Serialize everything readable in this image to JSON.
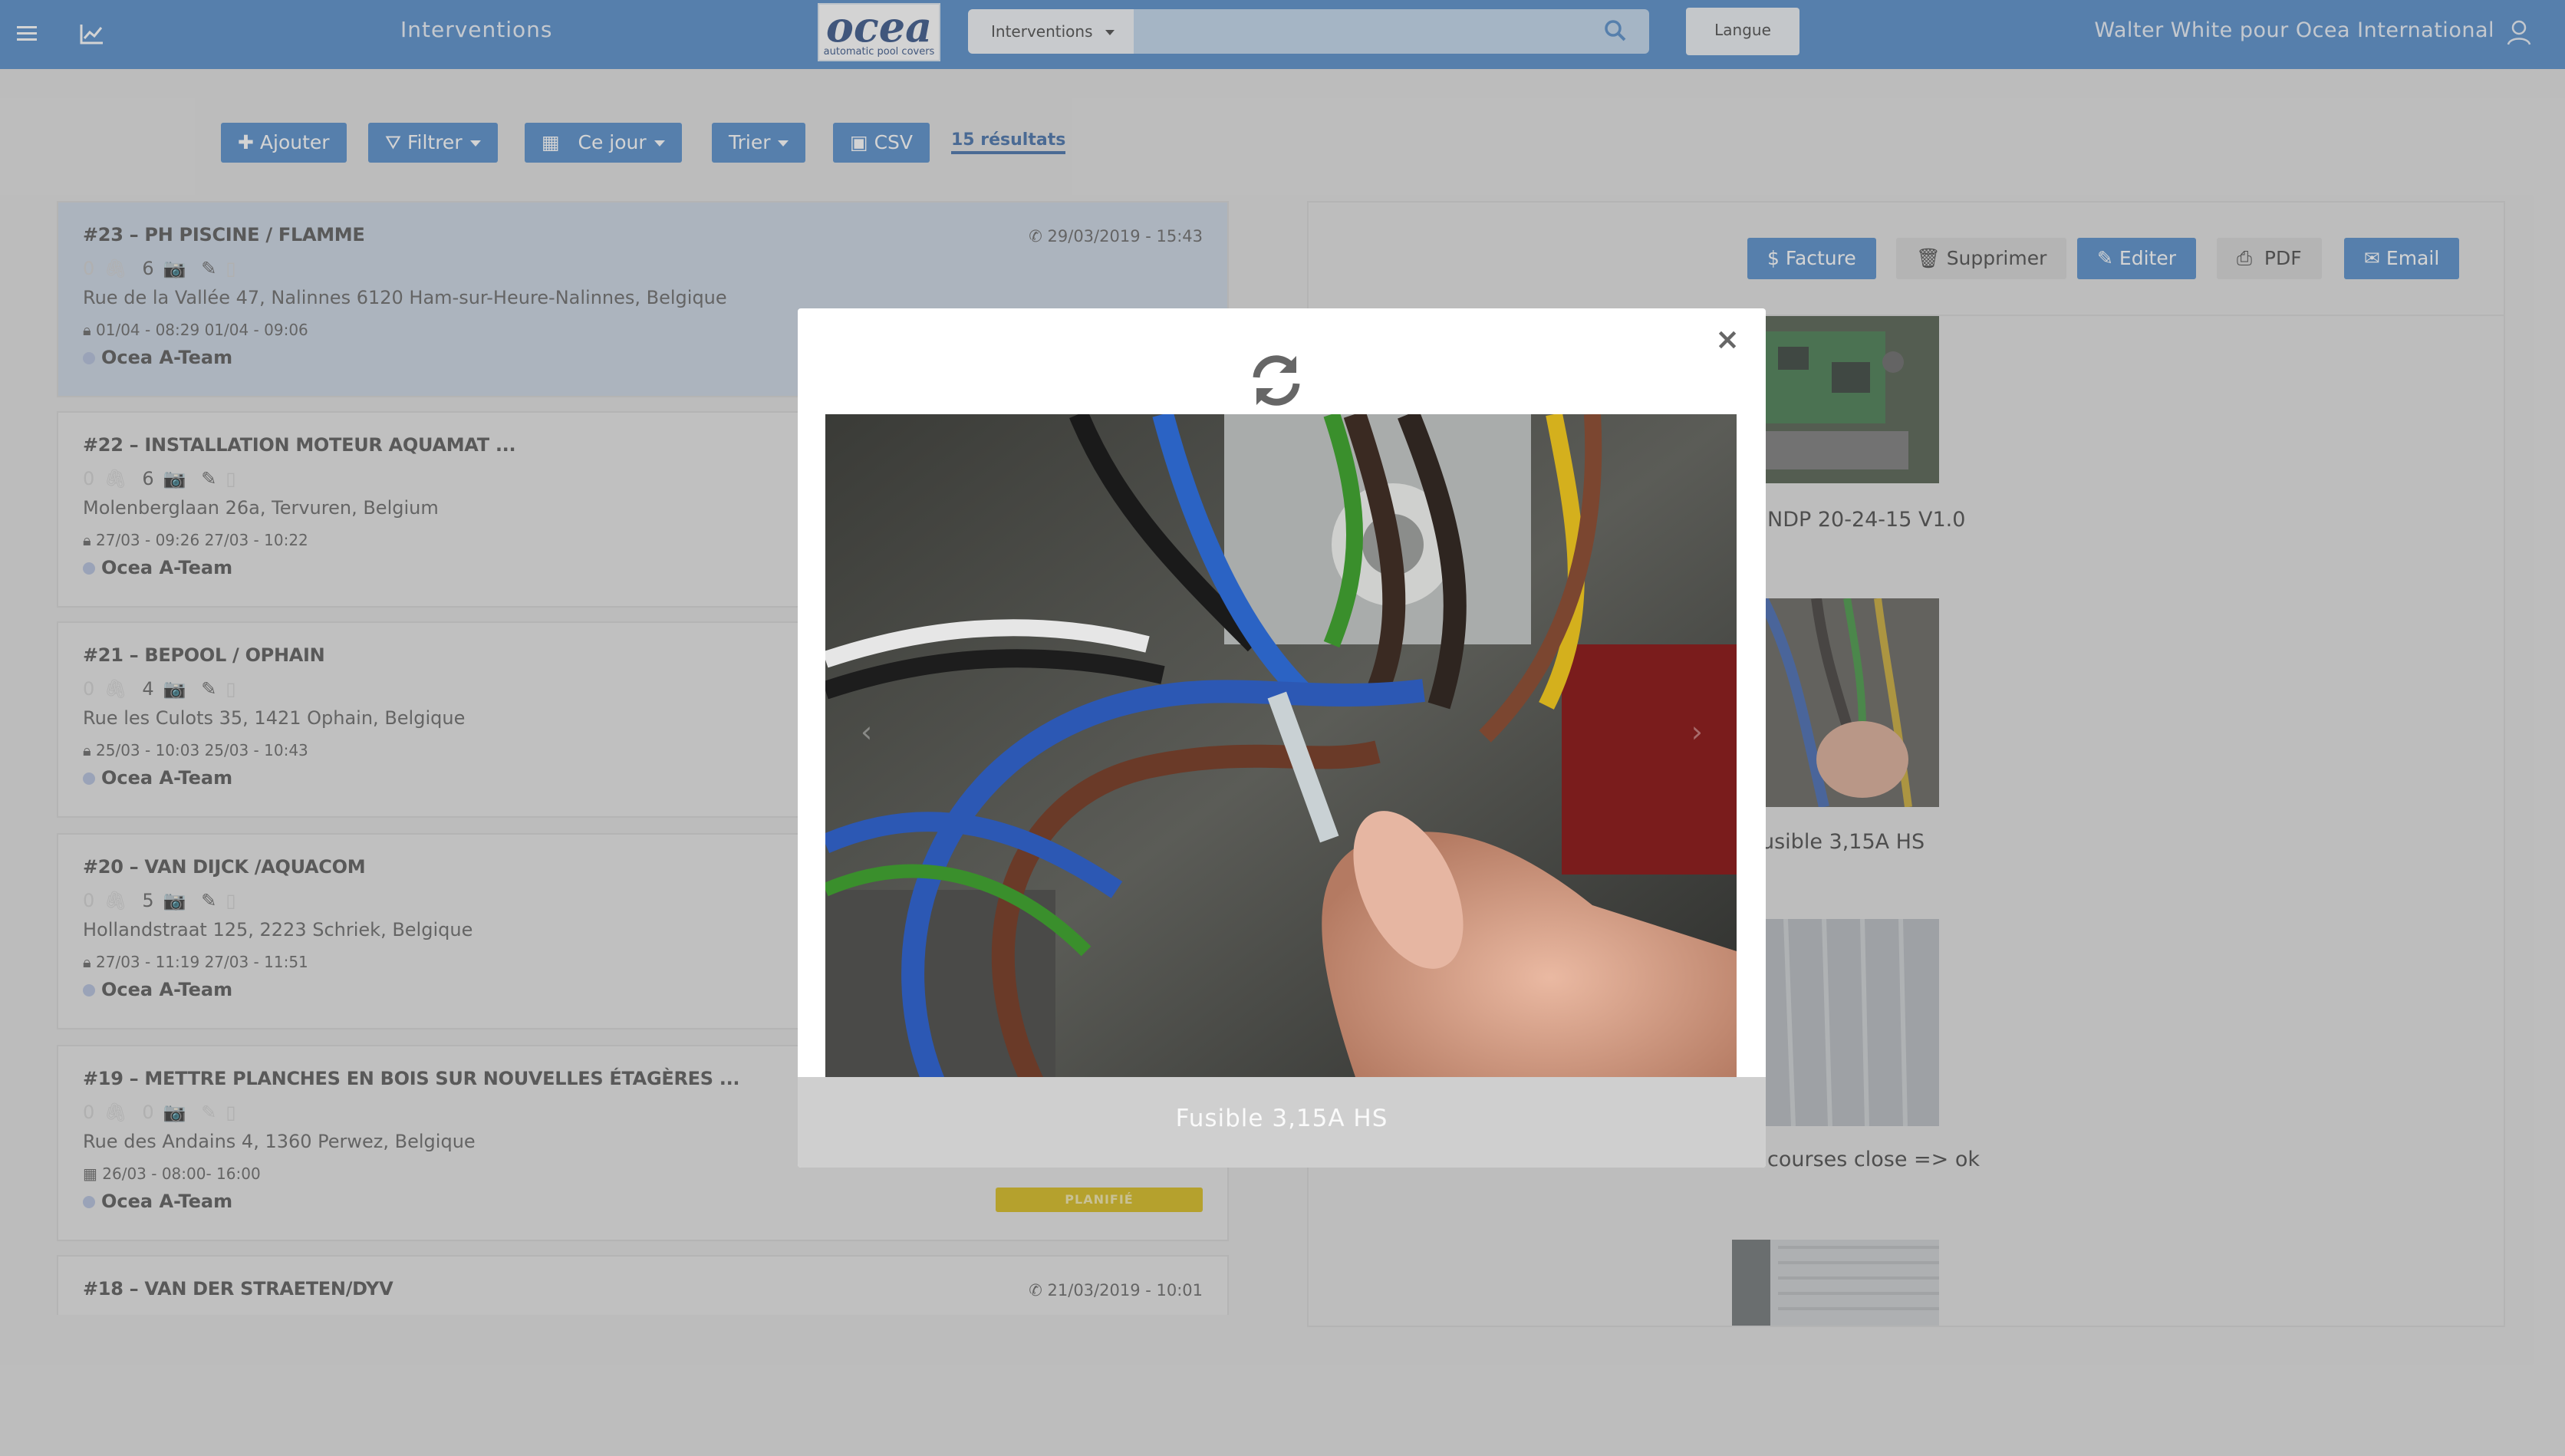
{
  "header": {
    "title": "Interventions",
    "logo_word": "ocea",
    "logo_tagline": "automatic pool covers",
    "search_scope": "Interventions",
    "language_button": "Langue",
    "user": "Walter White pour Ocea International"
  },
  "toolbar": {
    "add": "Ajouter",
    "filter": "Filtrer",
    "date": "Ce jour",
    "sort": "Trier",
    "csv": "CSV",
    "results": "15 résultats"
  },
  "list": {
    "items": [
      {
        "title": "#23 – PH PISCINE / FLAMME",
        "when": "29/03/2019 - 15:43",
        "attach": "0",
        "photos": "6",
        "address": "Rue de la Vallée 47, Nalinnes 6120 Ham-sur-Heure-Nalinnes, Belgique",
        "schedule": "01/04 - 08:29 01/04 - 09:06",
        "team": "Ocea A-Team"
      },
      {
        "title": "#22 – INSTALLATION MOTEUR AQUAMAT ...",
        "when": "",
        "attach": "0",
        "photos": "6",
        "address": "Molenberglaan 26a, Tervuren, Belgium",
        "schedule": "27/03 - 09:26 27/03 - 10:22",
        "team": "Ocea A-Team"
      },
      {
        "title": "#21 – BEPOOL / OPHAIN",
        "when": "",
        "attach": "0",
        "photos": "4",
        "address": "Rue les Culots 35, 1421 Ophain, Belgique",
        "schedule": "25/03 - 10:03 25/03 - 10:43",
        "team": "Ocea A-Team"
      },
      {
        "title": "#20 – VAN DIJCK /AQUACOM",
        "when": "",
        "attach": "0",
        "photos": "5",
        "address": "Hollandstraat 125, 2223 Schriek, Belgique",
        "schedule": "27/03 - 11:19 27/03 - 11:51",
        "team": "Ocea A-Team"
      },
      {
        "title": "#19 – METTRE PLANCHES EN BOIS SUR NOUVELLES ÉTAGÈRES ...",
        "when": "",
        "attach": "0",
        "photos": "0",
        "address": "Rue des Andains 4, 1360 Perwez, Belgique",
        "schedule": "26/03 - 08:00- 16:00",
        "team": "Ocea A-Team",
        "badge": "PLANIFIÉ"
      },
      {
        "title": "#18 – VAN DER STRAETEN/DYV",
        "when": "21/03/2019 - 10:01"
      }
    ]
  },
  "detail": {
    "buttons": {
      "invoice": "Facture",
      "delete": "Supprimer",
      "edit": "Editer",
      "pdf": "PDF",
      "email": "Email"
    },
    "captions": [
      "NDP 20-24-15 V1.0",
      "usible 3,15A HS",
      "courses close => ok"
    ]
  },
  "modal": {
    "caption": "Fusible 3,15A HS"
  },
  "colors": {
    "primary": "#3f7fc4",
    "badge": "#d1b200"
  }
}
